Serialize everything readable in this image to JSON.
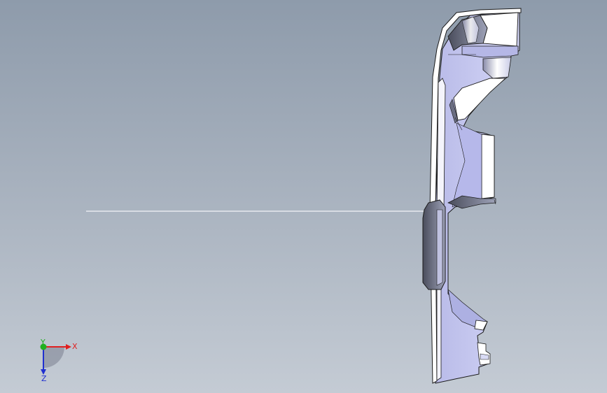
{
  "triad": {
    "x_label": "X",
    "y_label": "Y",
    "z_label": "Z"
  },
  "colors": {
    "background_top": "#8e9bab",
    "background_bottom": "#c4cbd4",
    "part_face": "#c6c8f2",
    "part_edge": "#1a1a1a",
    "x_axis": "#e02020",
    "y_axis": "#20b020",
    "z_axis": "#2030d0"
  }
}
